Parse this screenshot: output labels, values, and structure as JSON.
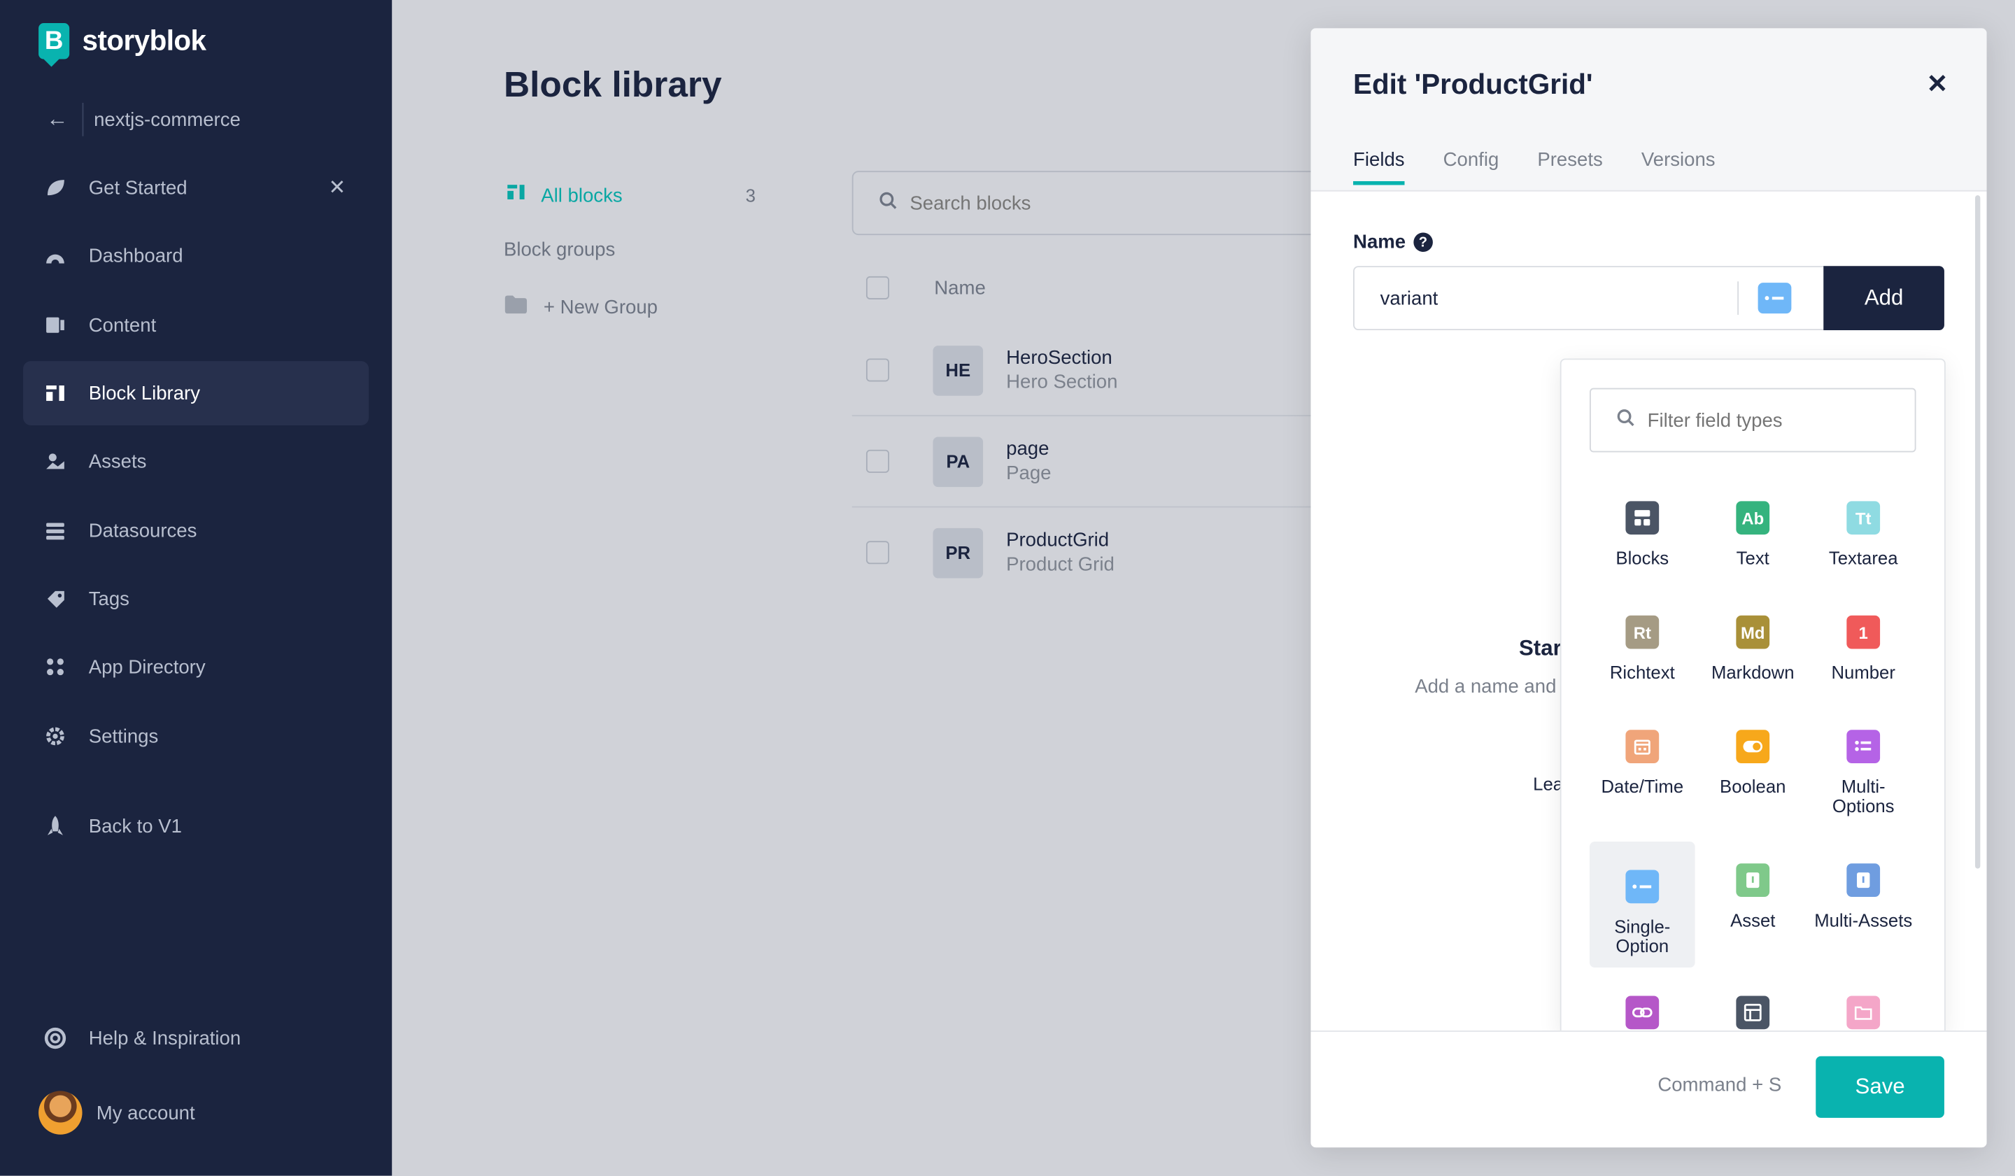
{
  "app": {
    "brand": "storyblok",
    "accent": "#09b3af",
    "sidebar_bg": "#1b243f"
  },
  "sidebar": {
    "space_name": "nextjs-commerce",
    "items": [
      {
        "label": "Get Started",
        "icon": "leaf-icon"
      },
      {
        "label": "Dashboard",
        "icon": "dashboard-icon"
      },
      {
        "label": "Content",
        "icon": "content-icon"
      },
      {
        "label": "Block Library",
        "icon": "block-library-icon",
        "active": true
      },
      {
        "label": "Assets",
        "icon": "image-icon"
      },
      {
        "label": "Datasources",
        "icon": "database-icon"
      },
      {
        "label": "Tags",
        "icon": "tag-icon"
      },
      {
        "label": "App Directory",
        "icon": "apps-icon"
      },
      {
        "label": "Settings",
        "icon": "gear-icon"
      },
      {
        "label": "Back to V1",
        "icon": "rocket-icon"
      }
    ],
    "help": "Help & Inspiration",
    "account": "My account"
  },
  "library": {
    "title": "Block library",
    "all_blocks": "All blocks",
    "all_count": "3",
    "groups_label": "Block groups",
    "new_group": "+ New Group",
    "search_placeholder": "Search blocks",
    "col_name": "Name",
    "rows": [
      {
        "badge": "HE",
        "name": "HeroSection",
        "display": "Hero Section"
      },
      {
        "badge": "PA",
        "name": "page",
        "display": "Page"
      },
      {
        "badge": "PR",
        "name": "ProductGrid",
        "display": "Product Grid"
      }
    ]
  },
  "modal": {
    "title": "Edit 'ProductGrid'",
    "tabs": [
      "Fields",
      "Config",
      "Presets",
      "Versions"
    ],
    "active_tab": "Fields",
    "name_label": "Name",
    "name_value": "variant",
    "add_label": "Add",
    "empty_title_partial": "Star",
    "empty_sub_partial": "Add a name and",
    "empty_link_partial": "Lea",
    "shortcut": "Command + S",
    "save_label": "Save",
    "filter_placeholder": "Filter field types",
    "field_types": [
      {
        "label": "Blocks",
        "icon": "blocks-icon",
        "color": "#4b5565"
      },
      {
        "label": "Text",
        "icon": "text-icon",
        "glyph": "Ab",
        "color": "#35b37e"
      },
      {
        "label": "Textarea",
        "icon": "textarea-icon",
        "glyph": "Tt",
        "color": "#8fdbe2"
      },
      {
        "label": "Richtext",
        "icon": "richtext-icon",
        "glyph": "Rt",
        "color": "#a59b84"
      },
      {
        "label": "Markdown",
        "icon": "markdown-icon",
        "glyph": "Md",
        "color": "#a99038"
      },
      {
        "label": "Number",
        "icon": "number-icon",
        "glyph": "1",
        "color": "#f05a5a"
      },
      {
        "label": "Date/Time",
        "icon": "calendar-icon",
        "color": "#f0a57a"
      },
      {
        "label": "Boolean",
        "icon": "toggle-icon",
        "color": "#f7a81b"
      },
      {
        "label": "Multi-\nOptions",
        "icon": "multi-options-icon",
        "color": "#b563e6"
      },
      {
        "label": "Single-\nOption",
        "icon": "single-option-icon",
        "color": "#6fb7f8",
        "selected": true
      },
      {
        "label": "Asset",
        "icon": "asset-icon",
        "color": "#7fc98a"
      },
      {
        "label": "Multi-Assets",
        "icon": "multi-assets-icon",
        "color": "#6f9de0"
      },
      {
        "label": "",
        "icon": "link-icon",
        "color": "#b557c8"
      },
      {
        "label": "",
        "icon": "table-icon",
        "color": "#4b5565"
      },
      {
        "label": "",
        "icon": "folder-icon",
        "color": "#f4a6c8"
      }
    ]
  }
}
